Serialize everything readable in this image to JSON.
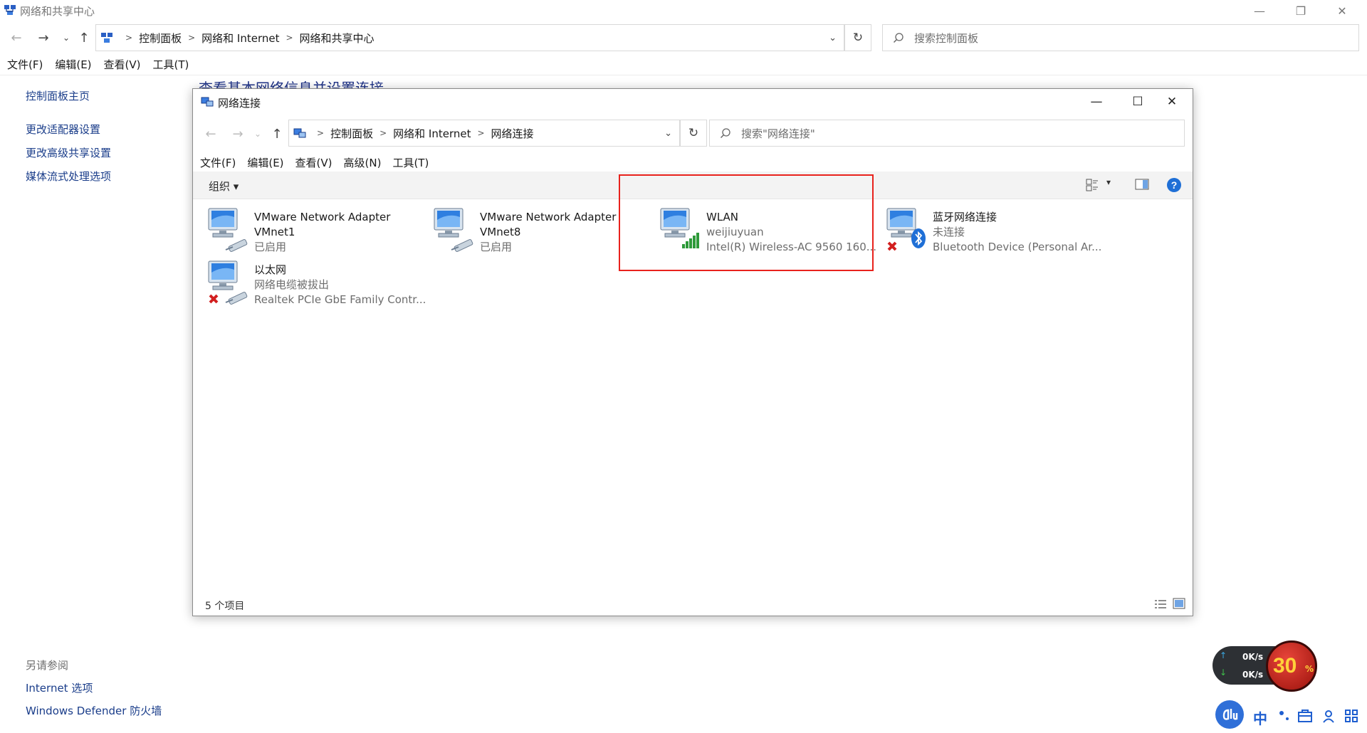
{
  "outer": {
    "title": "网络和共享中心",
    "breadcrumb": [
      "控制面板",
      "网络和 Internet",
      "网络和共享中心"
    ],
    "search_placeholder": "搜索控制面板",
    "menu": [
      "文件(F)",
      "编辑(E)",
      "查看(V)",
      "工具(T)"
    ],
    "left_links": [
      "控制面板主页",
      "更改适配器设置",
      "更改高级共享设置",
      "媒体流式处理选项"
    ],
    "see_also_title": "另请参阅",
    "see_also_links": [
      "Internet 选项",
      "Windows Defender 防火墙"
    ],
    "heading": "查看基本网络信息并设置连接"
  },
  "inner": {
    "title": "网络连接",
    "breadcrumb": [
      "控制面板",
      "网络和 Internet",
      "网络连接"
    ],
    "search_placeholder": "搜索\"网络连接\"",
    "menu": [
      "文件(F)",
      "编辑(E)",
      "查看(V)",
      "高级(N)",
      "工具(T)"
    ],
    "organize_label": "组织 ▾",
    "status": "5 个项目",
    "items": [
      {
        "line1": "VMware Network Adapter",
        "line2": "VMnet1",
        "line3": "已启用",
        "icon": "ethernet-adapter-icon"
      },
      {
        "line1": "VMware Network Adapter",
        "line2": "VMnet8",
        "line3": "已启用",
        "icon": "ethernet-adapter-icon"
      },
      {
        "line1": "WLAN",
        "line2": "weijiuyuan",
        "line3": "Intel(R) Wireless-AC 9560 160...",
        "icon": "wifi-adapter-icon"
      },
      {
        "line1": "蓝牙网络连接",
        "line2": "未连接",
        "line3": "Bluetooth Device (Personal Ar...",
        "icon": "bluetooth-adapter-icon"
      },
      {
        "line1": "以太网",
        "line2": "网络电缆被拔出",
        "line3": "Realtek PCIe GbE Family Contr...",
        "icon": "ethernet-adapter-icon"
      }
    ]
  },
  "widget": {
    "upload": "0K/s",
    "download": "0K/s",
    "percent": "30",
    "percent_sign": "%"
  },
  "ime": {
    "lang": "中"
  }
}
